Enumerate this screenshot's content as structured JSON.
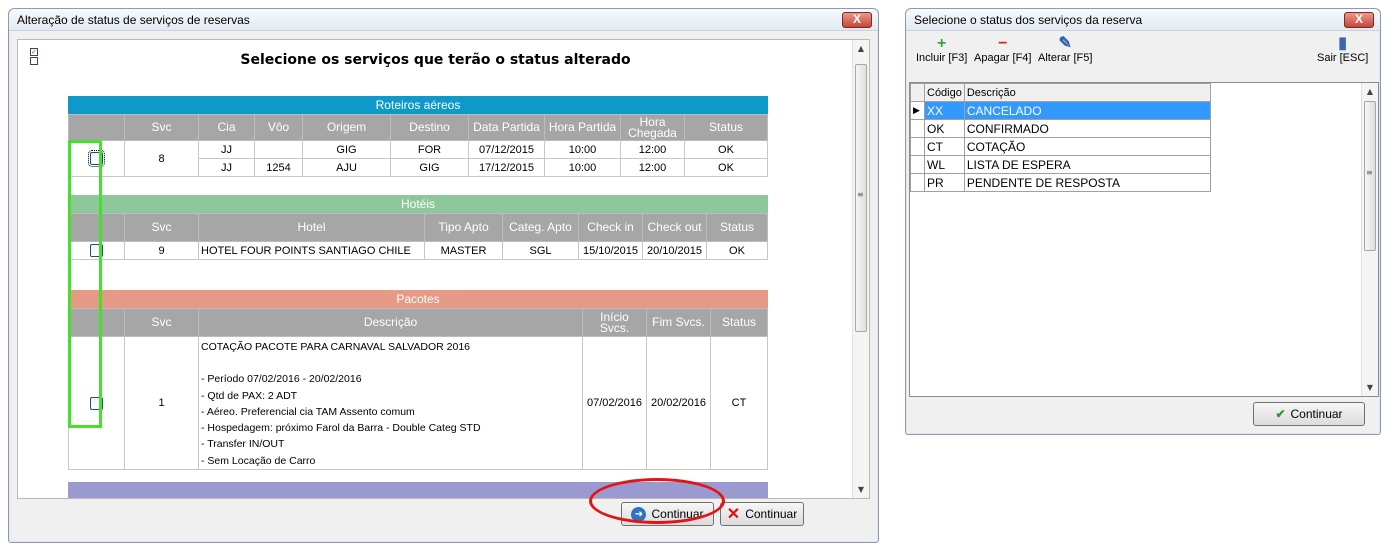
{
  "main": {
    "title": "Alteração de status de serviços de reservas",
    "close": "X",
    "heading": "Selecione os serviços que terão o status alterado",
    "flights": {
      "band": "Roteiros aéreos",
      "band_color": "#0e9ac8",
      "headers": [
        "Svc",
        "Cia",
        "Vôo",
        "Origem",
        "Destino",
        "Data Partida",
        "Hora Partida",
        "Hora Chegada",
        "Status"
      ],
      "svc": "8",
      "rows": [
        [
          "JJ",
          "",
          "GIG",
          "FOR",
          "07/12/2015",
          "10:00",
          "12:00",
          "OK"
        ],
        [
          "JJ",
          "1254",
          "AJU",
          "GIG",
          "17/12/2015",
          "10:00",
          "12:00",
          "OK"
        ]
      ]
    },
    "hotels": {
      "band": "Hotéis",
      "band_color": "#8ec89a",
      "headers": [
        "Svc",
        "Hotel",
        "Tipo Apto",
        "Categ. Apto",
        "Check in",
        "Check out",
        "Status"
      ],
      "row": [
        "9",
        "HOTEL FOUR POINTS SANTIAGO CHILE",
        "MASTER",
        "SGL",
        "15/10/2015",
        "20/10/2015",
        "OK"
      ]
    },
    "packages": {
      "band": "Pacotes",
      "band_color": "#e49a84",
      "headers": [
        "Svc",
        "Descrição",
        "Início Svcs.",
        "Fim Svcs.",
        "Status"
      ],
      "svc": "1",
      "description": [
        "COTAÇÃO PACOTE PARA CARNAVAL SALVADOR 2016",
        "",
        "- Período 07/02/2016 - 20/02/2016",
        "- Qtd de PAX: 2 ADT",
        "- Aéreo. Preferencial cia TAM Assento comum",
        "- Hospedagem: próximo Farol da Barra - Double Categ STD",
        "- Transfer IN/OUT",
        "- Sem Locação de Carro"
      ],
      "start": "07/02/2016",
      "end": "20/02/2016",
      "status": "CT"
    },
    "next_band_color": "#9a9ad0",
    "buttons": {
      "continue": "Continuar",
      "cancel": "Continuar"
    }
  },
  "status_window": {
    "title": "Selecione o status dos serviços da reserva",
    "close": "X",
    "toolbar": [
      {
        "label": "Incluir [F3]",
        "icon": "plus-icon"
      },
      {
        "label": "Apagar [F4]",
        "icon": "minus-icon"
      },
      {
        "label": "Alterar [F5]",
        "icon": "edit-icon"
      },
      {
        "label": "Sair [ESC]",
        "icon": "exit-door-icon"
      }
    ],
    "headers": [
      "Código",
      "Descrição"
    ],
    "rows": [
      [
        "XX",
        "CANCELADO"
      ],
      [
        "OK",
        "CONFIRMADO"
      ],
      [
        "CT",
        "COTAÇÃO"
      ],
      [
        "WL",
        "LISTA DE ESPERA"
      ],
      [
        "PR",
        "PENDENTE DE RESPOSTA"
      ]
    ],
    "selected_row": 0,
    "button": "Continuar"
  }
}
